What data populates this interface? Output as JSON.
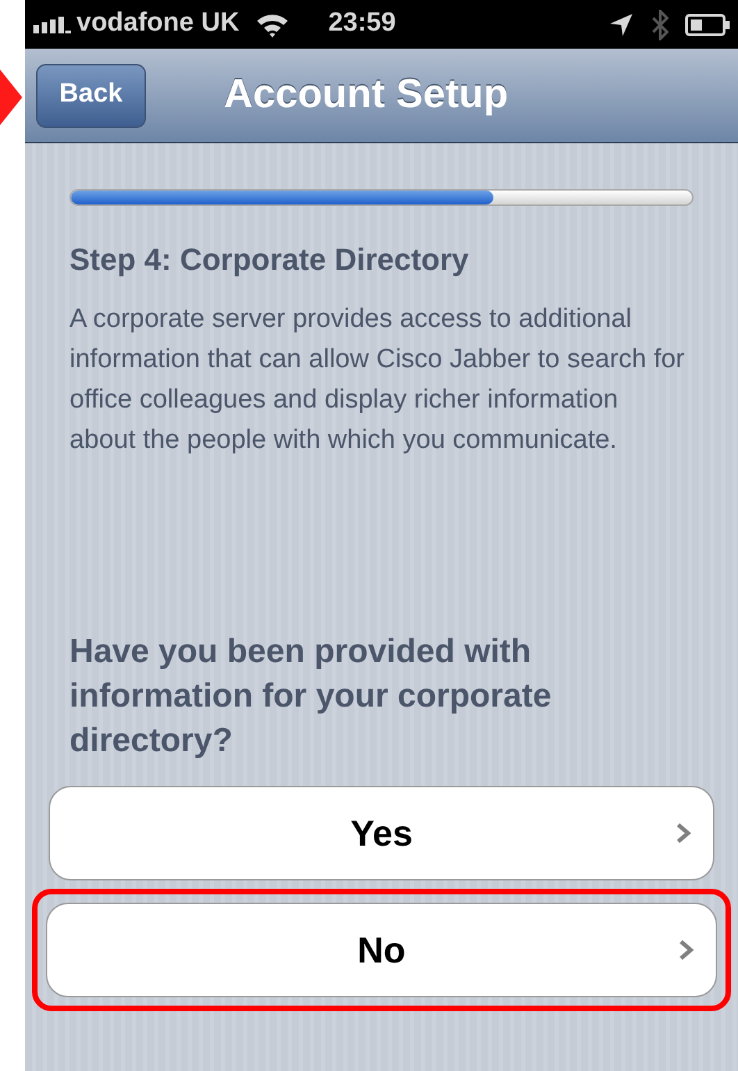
{
  "status_bar": {
    "carrier": "vodafone UK",
    "time": "23:59"
  },
  "nav_bar": {
    "back_button": {
      "label": "Back",
      "highlighted": true
    },
    "title": "Account Setup"
  },
  "progress": {
    "level": 0.68
  },
  "step_title": "Step 4: Corporate Directory",
  "description": "A corporate server provides access to additional information that can allow Cisco Jabber to search for office colleagues and display richer information about the people with which you communicate.",
  "question": "Have you been provided with information for your corporate directory?",
  "options": [
    {
      "label": "Yes",
      "highlighted": false
    },
    {
      "label": "No",
      "highlighted": true
    }
  ]
}
